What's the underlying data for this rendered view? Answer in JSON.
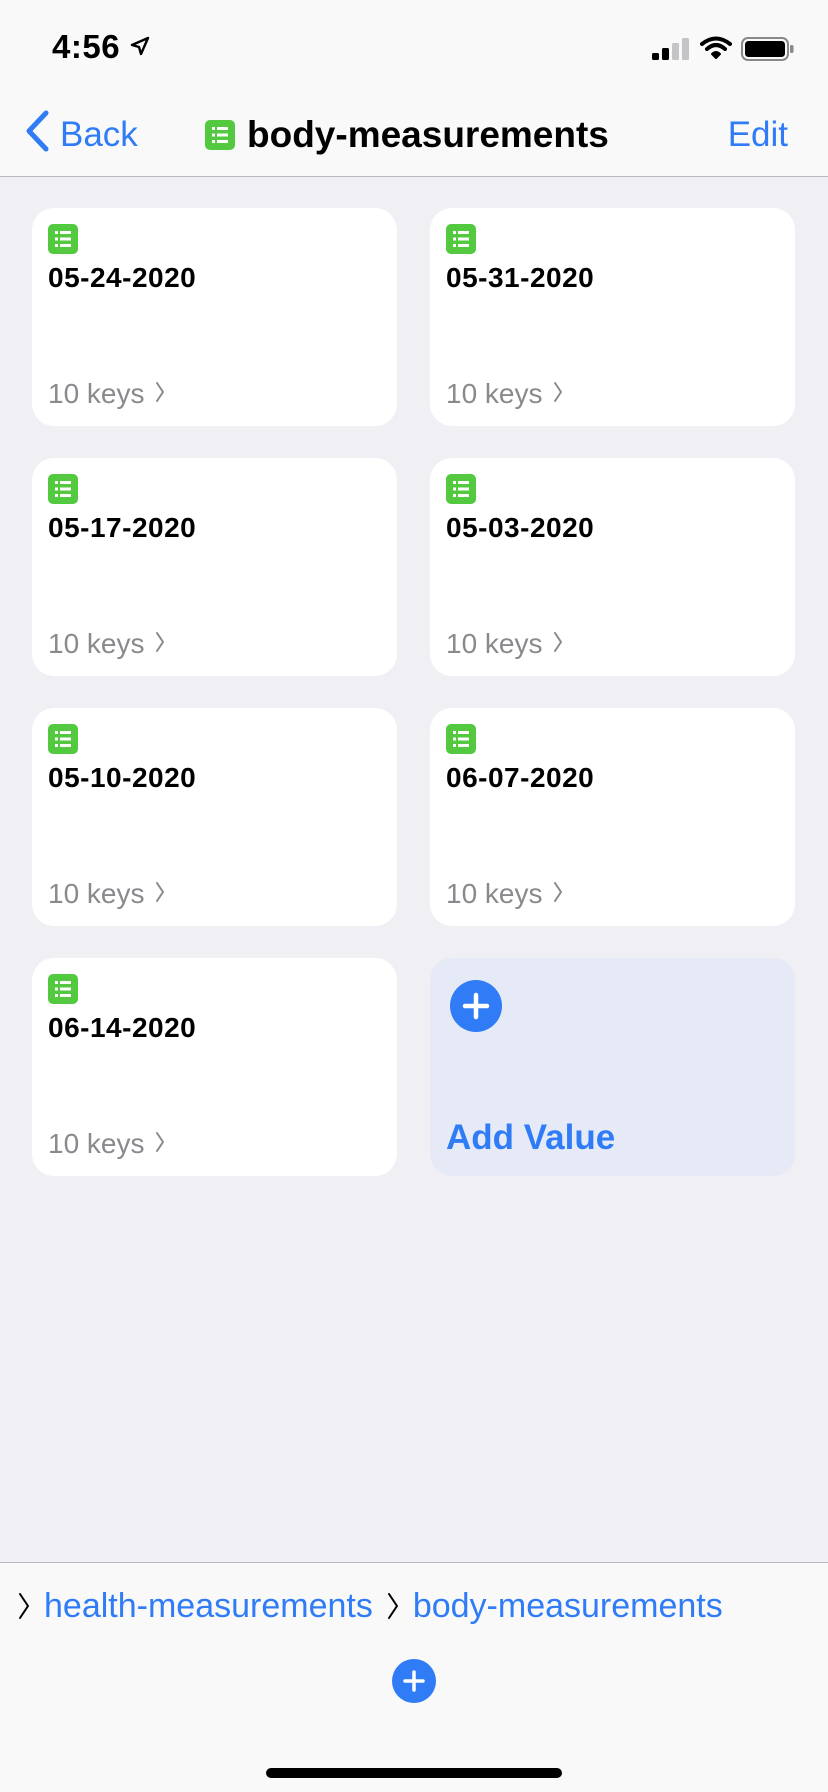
{
  "status": {
    "time": "4:56",
    "icons": [
      "location-arrow-icon",
      "cellular-signal-icon",
      "wifi-icon",
      "battery-icon"
    ]
  },
  "nav": {
    "back_label": "Back",
    "title": "body-measurements",
    "title_icon": "table-icon",
    "edit_label": "Edit"
  },
  "cards": [
    {
      "title": "05-24-2020",
      "subtitle": "10 keys"
    },
    {
      "title": "05-31-2020",
      "subtitle": "10 keys"
    },
    {
      "title": "05-17-2020",
      "subtitle": "10 keys"
    },
    {
      "title": "05-03-2020",
      "subtitle": "10 keys"
    },
    {
      "title": "05-10-2020",
      "subtitle": "10 keys"
    },
    {
      "title": "06-07-2020",
      "subtitle": "10 keys"
    },
    {
      "title": "06-14-2020",
      "subtitle": "10 keys"
    }
  ],
  "add_card": {
    "label": "Add Value",
    "icon": "plus-circle-icon"
  },
  "breadcrumb": {
    "items": [
      "health-measurements",
      "body-measurements"
    ]
  },
  "colors": {
    "accent": "#2f7cf6",
    "table_icon": "#52c93f",
    "background": "#efeff4",
    "add_card_bg": "#e6eaf6",
    "secondary_text": "#8a8a8e"
  }
}
